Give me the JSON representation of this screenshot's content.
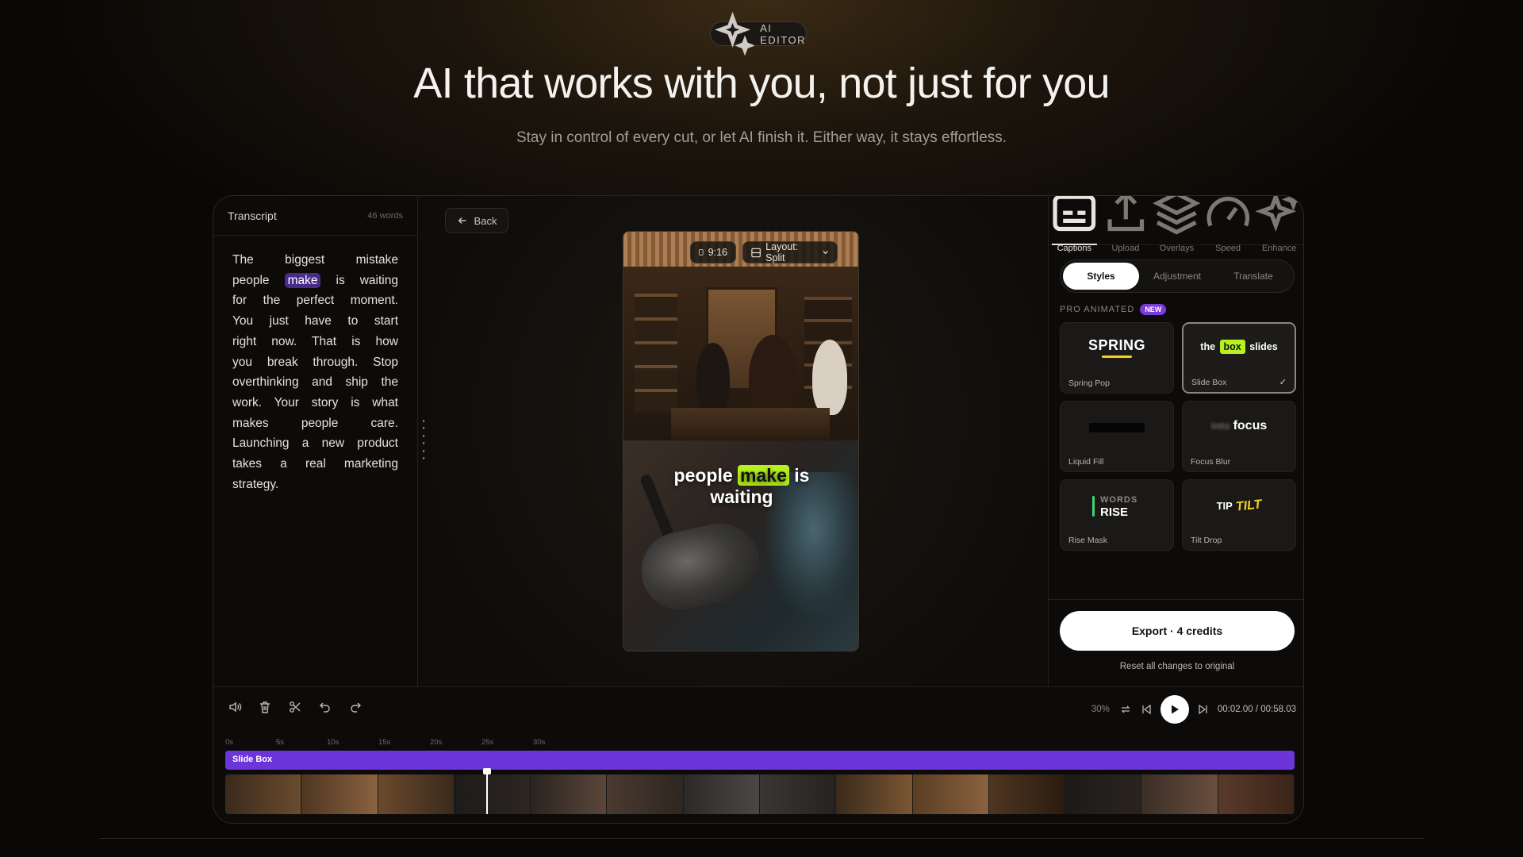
{
  "hero": {
    "badge": "AI EDITOR",
    "title": "AI that works with you, not just for you",
    "subtitle": "Stay in control of every cut, or let AI finish it. Either way, it stays effortless."
  },
  "transcript": {
    "title": "Transcript",
    "word_count": "46 words",
    "before_highlight": "The biggest mistake people",
    "highlight": "make",
    "after_highlight": "is waiting for the perfect moment. You just have to start right now. That is how you break through. Stop overthinking and ship the work. Your story is what makes people care. Launching a new product takes a real marketing strategy."
  },
  "preview": {
    "back_label": "Back",
    "aspect_ratio": "9:16",
    "layout_label": "Layout: Split",
    "caption_before": "people",
    "caption_highlight": "make",
    "caption_after": "is",
    "caption_line2": "waiting"
  },
  "right_panel": {
    "tabs": [
      {
        "label": "Captions",
        "icon": "captions-icon",
        "active": true
      },
      {
        "label": "Upload",
        "icon": "upload-icon",
        "active": false
      },
      {
        "label": "Overlays",
        "icon": "layers-icon",
        "active": false
      },
      {
        "label": "Speed",
        "icon": "speed-icon",
        "active": false
      },
      {
        "label": "Enhance",
        "icon": "sparkle-icon",
        "active": false
      }
    ],
    "segments": [
      "Styles",
      "Adjustment",
      "Translate"
    ],
    "section_label": "PRO ANIMATED",
    "new_badge": "NEW",
    "styles": [
      {
        "name": "Spring Pop",
        "preview": "SPRING"
      },
      {
        "name": "Slide Box",
        "preview_before": "the",
        "preview_box": "box",
        "preview_after": "slides",
        "selected": true
      },
      {
        "name": "Liquid Fill"
      },
      {
        "name": "Focus Blur",
        "preview_blur": "into",
        "preview": "focus"
      },
      {
        "name": "Rise Mask",
        "preview_top": "WORDS",
        "preview_bottom": "RISE"
      },
      {
        "name": "Tilt Drop",
        "preview_left": "TIP",
        "preview_right": "TILT"
      }
    ],
    "export_label": "Export · 4 credits",
    "reset_label": "Reset all changes to original"
  },
  "timeline": {
    "zoom": "30%",
    "time": "00:02.00 / 00:58.03",
    "ruler": [
      "0s",
      "5s",
      "10s",
      "15s",
      "20s",
      "25s",
      "30s"
    ],
    "track_label": "Slide Box",
    "accent_color": "#6c35d9",
    "highlight_color": "#b6f21f"
  }
}
